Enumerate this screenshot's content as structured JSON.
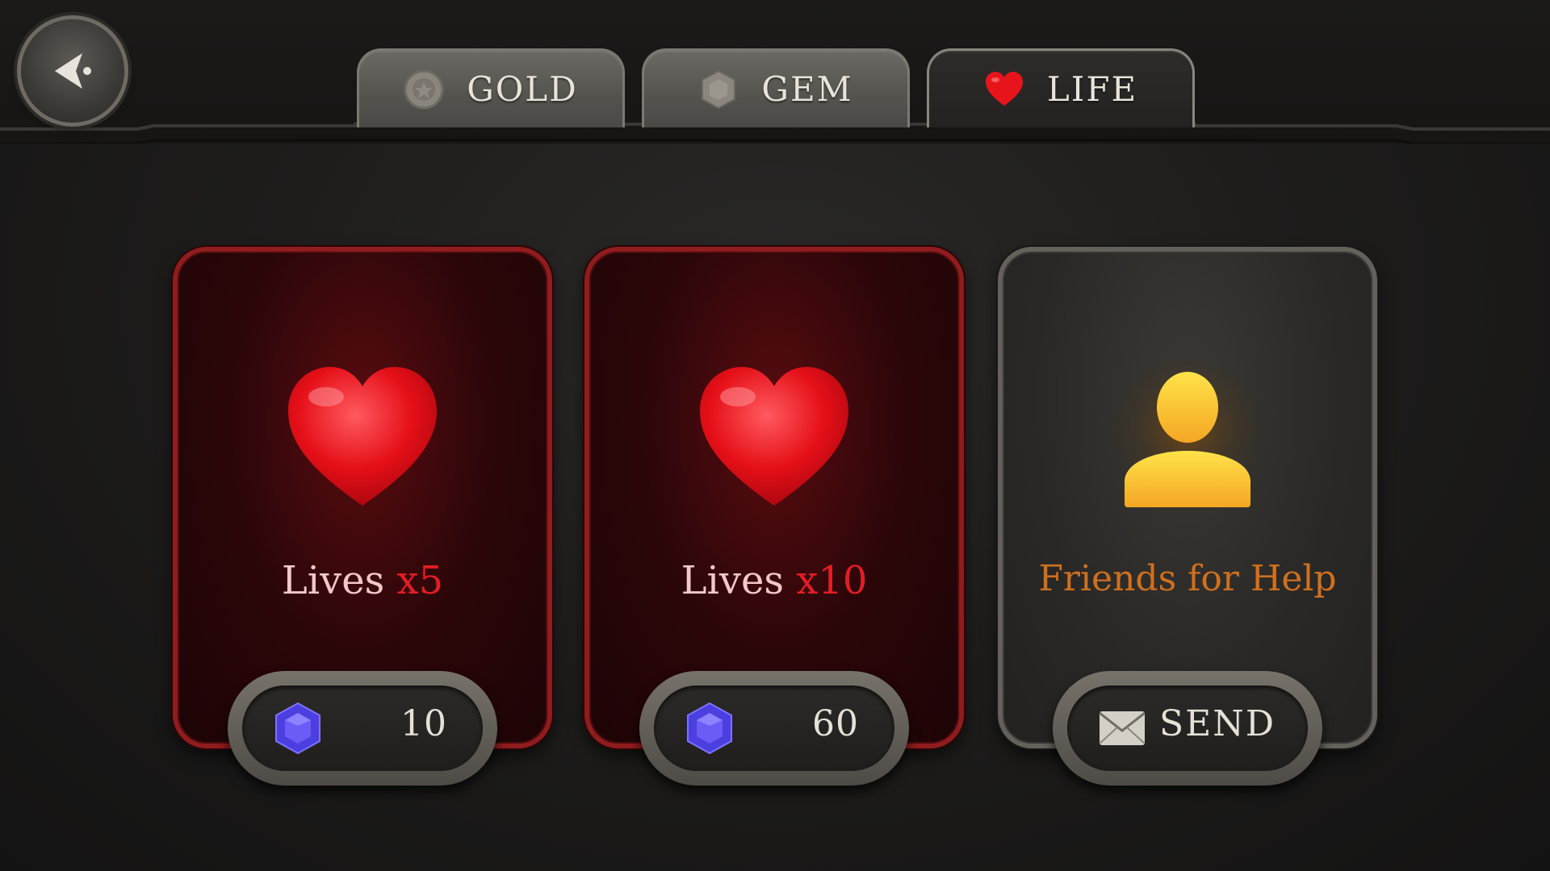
{
  "tabs": [
    {
      "label": "GOLD",
      "icon": "coin-icon",
      "active": false
    },
    {
      "label": "GEM",
      "icon": "gem-icon",
      "active": false
    },
    {
      "label": "LIFE",
      "icon": "heart-icon",
      "active": true
    }
  ],
  "back": {
    "icon": "back-arrow-icon"
  },
  "cards": [
    {
      "icon": "heart-icon",
      "title_main": "Lives",
      "title_qty": "x5",
      "price": "10",
      "price_icon": "gem-icon"
    },
    {
      "icon": "heart-icon",
      "title_main": "Lives",
      "title_qty": "x10",
      "price": "60",
      "price_icon": "gem-icon"
    },
    {
      "icon": "friend-icon",
      "title": "Friends for Help",
      "button": "SEND",
      "button_icon": "envelope-icon"
    }
  ],
  "colors": {
    "accent_red": "#e21d24",
    "friend_orange": "#d0701e",
    "gem_blue": "#5a4df0"
  }
}
